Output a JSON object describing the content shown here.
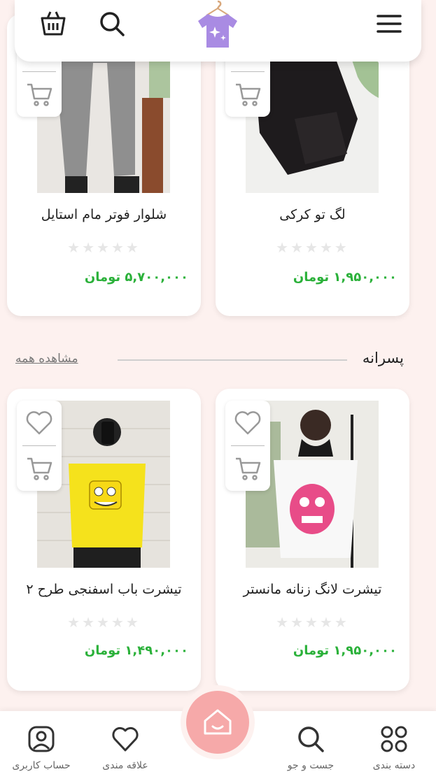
{
  "header": {
    "icons": [
      "basket-icon",
      "search-icon",
      "tshirt-logo",
      "menu-icon"
    ],
    "logo_color": "#a98be3"
  },
  "products_top": [
    {
      "title": "لگ تو کرکی",
      "price": "۱,۹۵۰,۰۰۰ تومان",
      "rating": "★★★★★"
    },
    {
      "title": "شلوار فوتر مام استایل",
      "price": "۵,۷۰۰,۰۰۰ تومان",
      "rating": "★★★★★"
    }
  ],
  "section": {
    "title": "پسرانه",
    "see_all": "مشاهده همه"
  },
  "products_bottom": [
    {
      "title": "تیشرت لانگ زنانه مانستر",
      "price": "۱,۹۵۰,۰۰۰ تومان",
      "rating": "★★★★★"
    },
    {
      "title": "تیشرت باب اسفنجی طرح ۲",
      "price": "۱,۴۹۰,۰۰۰ تومان",
      "rating": "★★★★★"
    }
  ],
  "bottom_nav": {
    "categories": "دسته بندی",
    "search": "جست و جو",
    "favorites": "علاقه مندی",
    "account": "حساب کاربری"
  },
  "colors": {
    "price": "#2bb13a",
    "home_button": "#f6a9a9",
    "background": "#fdf1ef"
  }
}
